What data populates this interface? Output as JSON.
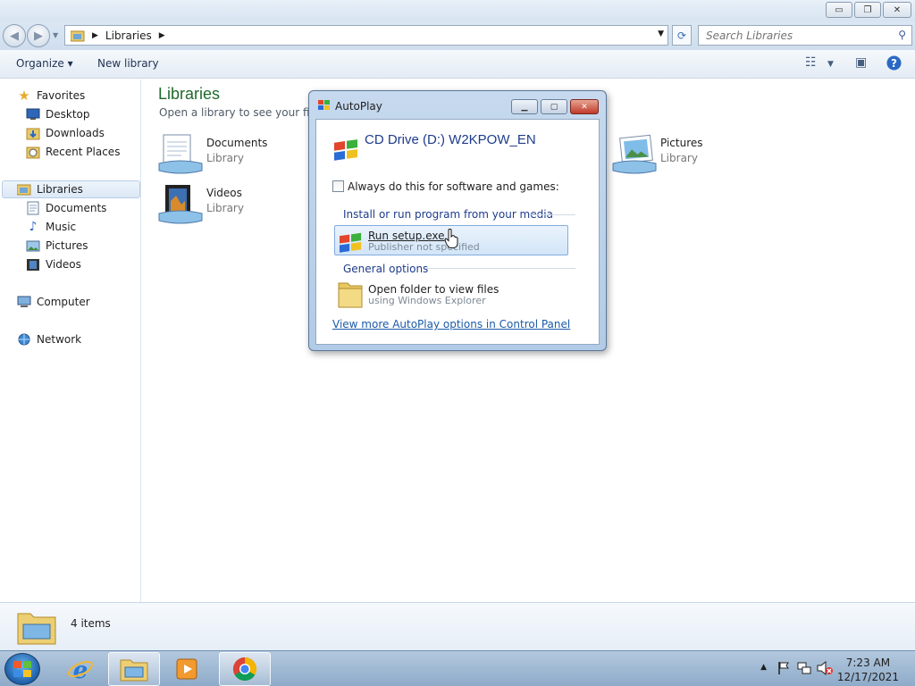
{
  "window": {
    "minimize_glyph": "▭",
    "restore_glyph": "❐",
    "close_glyph": "✕"
  },
  "address_bar": {
    "breadcrumb": "Libraries",
    "search_placeholder": "Search Libraries"
  },
  "toolbar": {
    "organize_label": "Organize ▾",
    "new_library_label": "New library"
  },
  "sidebar": {
    "favorites": {
      "label": "Favorites",
      "items": [
        {
          "label": "Desktop"
        },
        {
          "label": "Downloads"
        },
        {
          "label": "Recent Places"
        }
      ]
    },
    "libraries": {
      "label": "Libraries",
      "items": [
        {
          "label": "Documents"
        },
        {
          "label": "Music"
        },
        {
          "label": "Pictures"
        },
        {
          "label": "Videos"
        }
      ]
    },
    "computer_label": "Computer",
    "network_label": "Network"
  },
  "content": {
    "title": "Libraries",
    "subtitle": "Open a library to see your files a",
    "items": [
      {
        "name": "Documents",
        "type": "Library"
      },
      {
        "name": "Videos",
        "type": "Library"
      },
      {
        "name": "Pictures",
        "type": "Library"
      }
    ]
  },
  "status": {
    "item_count": "4 items"
  },
  "autoplay": {
    "title": "AutoPlay",
    "drive_title": "CD Drive (D:) W2KPOW_EN",
    "always_label": "Always do this for software and games:",
    "always_checked": false,
    "install_section": "Install or run program from your media",
    "run_option": {
      "title": "Run setup.exe",
      "subtitle": "Publisher not specified"
    },
    "general_section": "General options",
    "open_option": {
      "title": "Open folder to view files",
      "subtitle": "using Windows Explorer"
    },
    "more_link": "View more AutoPlay options in Control Panel"
  },
  "taskbar": {
    "time": "7:23 AM",
    "date": "12/17/2021",
    "pinned": [
      "internet-explorer",
      "windows-explorer",
      "media-player",
      "chrome"
    ]
  },
  "colors": {
    "title_green": "#1e6a2d",
    "link_blue": "#1b5aa8",
    "heading_blue": "#1e3c8c"
  }
}
